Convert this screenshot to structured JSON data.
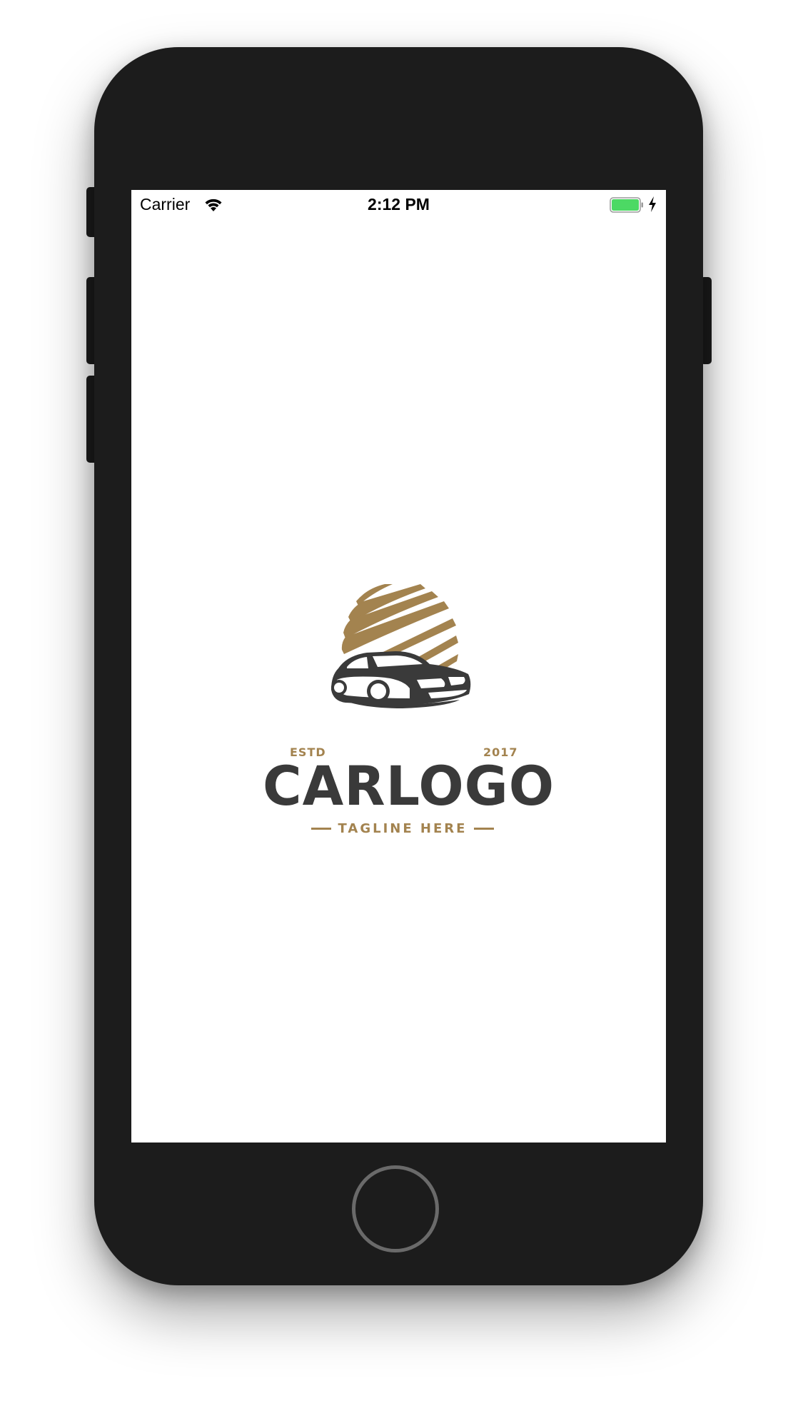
{
  "status_bar": {
    "carrier": "Carrier",
    "time": "2:12 PM",
    "battery_color": "#4cd964",
    "icons": [
      "wifi-icon",
      "battery-icon",
      "charging-bolt-icon"
    ]
  },
  "logo": {
    "estd_label": "ESTD",
    "year": "2017",
    "brand_name": "CARLOGO",
    "tagline": "TAGLINE HERE",
    "accent_color": "#a3834f",
    "primary_color": "#3a3a3a"
  },
  "device": {
    "body_color": "#1c1c1c"
  }
}
